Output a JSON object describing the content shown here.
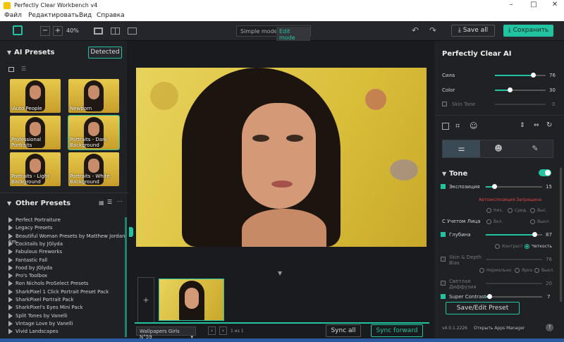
{
  "app": {
    "title": "Perfectly Clear Workbench v4",
    "accent": "#22c3a0"
  },
  "menu": [
    "Файл",
    "Редактировать",
    "Вид",
    "Справка"
  ],
  "toolbar": {
    "zoom": "40%",
    "mode_simple": "Simple mode",
    "mode_edit": "Edit mode",
    "save_all": "Save all",
    "save": "Сохранить"
  },
  "left": {
    "ai_presets_title": "AI Presets",
    "detected_button": "Detected",
    "presets": [
      "iAuto People",
      "Newborn",
      "Professional Portraits",
      "Portraits - Dark Background",
      "Portraits - Light Background",
      "Portraits - White Background"
    ],
    "other_presets_title": "Other Presets",
    "other_presets": [
      "Perfect Portraiture",
      "Legacy Presets",
      "Beautiful Woman Presets by Matthew Jordan Sm...",
      "Cocktails by JGlyda",
      "Fabulous Fireworks",
      "Fantastic Fall",
      "Food by JGlyda",
      "Pro's Toolbox",
      "Ron Nichols ProSelect Presets",
      "SharkPixel 1 Click Portrait Preset Pack",
      "SharkPixel Portrait Pack",
      "SharkPixel's Eyes Mini Pack",
      "Split Tones by Vanelli",
      "Vintage Love by Vanelli",
      "Vivid Landscapes"
    ]
  },
  "bottom": {
    "album": "Wallpapers Girls N°59",
    "page": "1 из 1",
    "sync_all": "Sync all",
    "sync_forward": "Sync forward"
  },
  "right": {
    "title": "Perfectly Clear AI",
    "strength_label": "Сила",
    "strength_value": "76",
    "color_label": "Color",
    "color_value": "30",
    "skin_tone_label": "Skin Tone",
    "skin_tone_value": "0",
    "tone_title": "Tone",
    "exposure_label": "Экспозиция",
    "exposure_value": "15",
    "auto_warning": "Автоэкспозиция Запрещена",
    "exposure_modes": [
      "Низ.",
      "Сред.",
      "Выс."
    ],
    "face_label": "С Учетом Лица",
    "face_modes": [
      "Вкл.",
      "Выкл."
    ],
    "depth_label": "Глубина",
    "depth_value": "87",
    "depth_modes": [
      "Контраст",
      "Четкость"
    ],
    "skin_depth_label": "Skin & Depth Bias",
    "skin_depth_value": "76",
    "bias_modes": [
      "Нормально",
      "Ярко",
      "Выкл."
    ],
    "light_diffusion_label": "Светлая Диффузия",
    "light_diffusion_value": "20",
    "super_contrast_label": "Super Contrast",
    "super_contrast_value": "7",
    "save_edit_preset": "Save/Edit Preset",
    "version": "v4.0.1.2226",
    "open_apps_manager": "Открыть Apps Manager"
  },
  "controls": {
    "strength": 0.76,
    "color": 0.3,
    "skin_tone": 0.0,
    "exposure": 0.15,
    "depth": 0.87,
    "super_contrast": 0.07
  }
}
